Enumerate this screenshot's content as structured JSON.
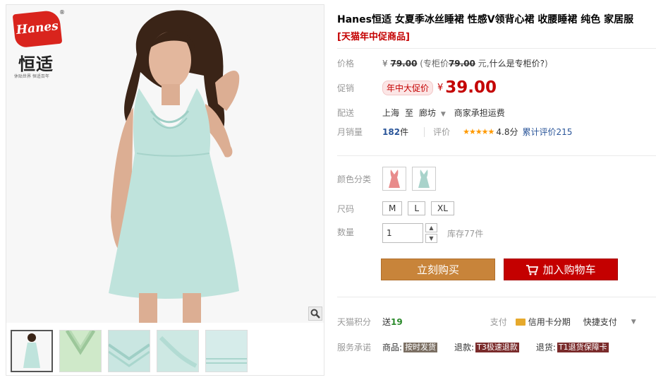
{
  "gallery": {
    "logo": {
      "brand": "Hanes",
      "brand_cn": "恒适",
      "tagline": "休贴世界 恒适百年"
    },
    "thumb_count": 5
  },
  "product": {
    "title": "Hanes恒适 女夏季冰丝睡裙 性感V领背心裙 收腰睡裙 纯色 家居服",
    "subtitle": "[天猫年中促商品]"
  },
  "price_row": {
    "label": "价格",
    "yen": "¥",
    "original": "79.00",
    "counter_prefix": "(专柜价",
    "counter_price": "79.00",
    "counter_suffix": "元,",
    "counter_link": "什么是专柜价?",
    "close": ")"
  },
  "promo_row": {
    "label": "促销",
    "tag": "年中大促价",
    "yen": "¥",
    "price": "39.00"
  },
  "ship_row": {
    "label": "配送",
    "from": "上海",
    "to_word": "至",
    "dest": "廊坊",
    "note": "商家承担运费"
  },
  "sales_row": {
    "label": "月销量",
    "count": "182",
    "unit": "件",
    "review_label": "评价",
    "stars": "★★★★★",
    "score": "4.8分",
    "review_total": "累计评价215"
  },
  "color_row": {
    "label": "颜色分类",
    "swatch_colors": [
      "#e88b8b",
      "#b8ddd6"
    ]
  },
  "size_row": {
    "label": "尺码",
    "sizes": [
      "M",
      "L",
      "XL"
    ]
  },
  "qty_row": {
    "label": "数量",
    "value": "1",
    "stock": "库存77件"
  },
  "actions": {
    "buy_now": "立刻购买",
    "add_to_cart": "加入购物车"
  },
  "points_row": {
    "label": "天猫积分",
    "send": "送",
    "points": "19",
    "pay_label": "支付",
    "installment": "信用卡分期",
    "quick_pay": "快捷支付"
  },
  "service_row": {
    "label": "服务承诺",
    "goods_label": "商品:",
    "goods_tag": "按时发货",
    "refund_label": "退款:",
    "refund_tag": "T3极速退款",
    "return_label": "退货:",
    "return_tag": "T1退货保障卡"
  },
  "colors": {
    "accent_red": "#c40000",
    "buy_orange": "#c8843a",
    "dress": "#bfe3dc",
    "star": "#ff9900"
  }
}
